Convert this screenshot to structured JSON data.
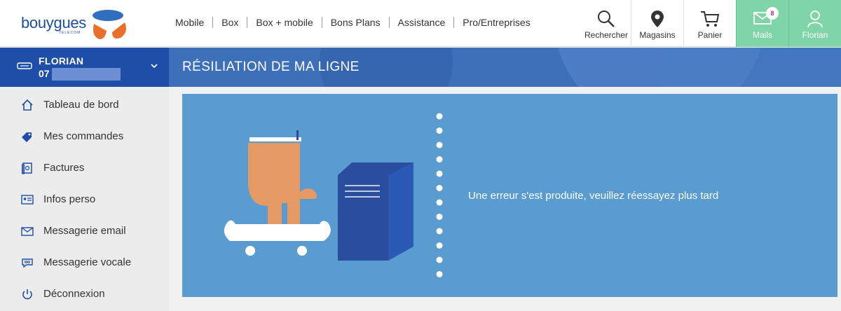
{
  "brand": {
    "name": "bouygues",
    "sub": "TELECOM"
  },
  "nav": [
    "Mobile",
    "Box",
    "Box + mobile",
    "Bons Plans",
    "Assistance",
    "Pro/Entreprises"
  ],
  "tools": {
    "search": "Rechercher",
    "stores": "Magasins",
    "cart": "Panier",
    "mails": "Mails",
    "mails_badge": "8",
    "account": "Florian"
  },
  "user": {
    "name": "FLORIAN",
    "line_prefix": "07"
  },
  "menu": [
    {
      "label": "Tableau de bord",
      "icon": "home-icon"
    },
    {
      "label": "Mes commandes",
      "icon": "tag-icon"
    },
    {
      "label": "Factures",
      "icon": "invoice-icon"
    },
    {
      "label": "Infos perso",
      "icon": "id-card-icon"
    },
    {
      "label": "Messagerie email",
      "icon": "envelope-icon"
    },
    {
      "label": "Messagerie vocale",
      "icon": "voicemail-icon"
    },
    {
      "label": "Déconnexion",
      "icon": "power-icon"
    }
  ],
  "page": {
    "title": "RÉSILIATION DE MA LIGNE",
    "error": "Une erreur s'est produite, veuillez réessayez plus tard"
  },
  "colors": {
    "brand_blue": "#1e4ea8",
    "banner_blue": "#3e6fb9",
    "card_blue": "#5a9bd0",
    "mails_green": "#7fd4a8",
    "logo_orange": "#e8702a"
  }
}
